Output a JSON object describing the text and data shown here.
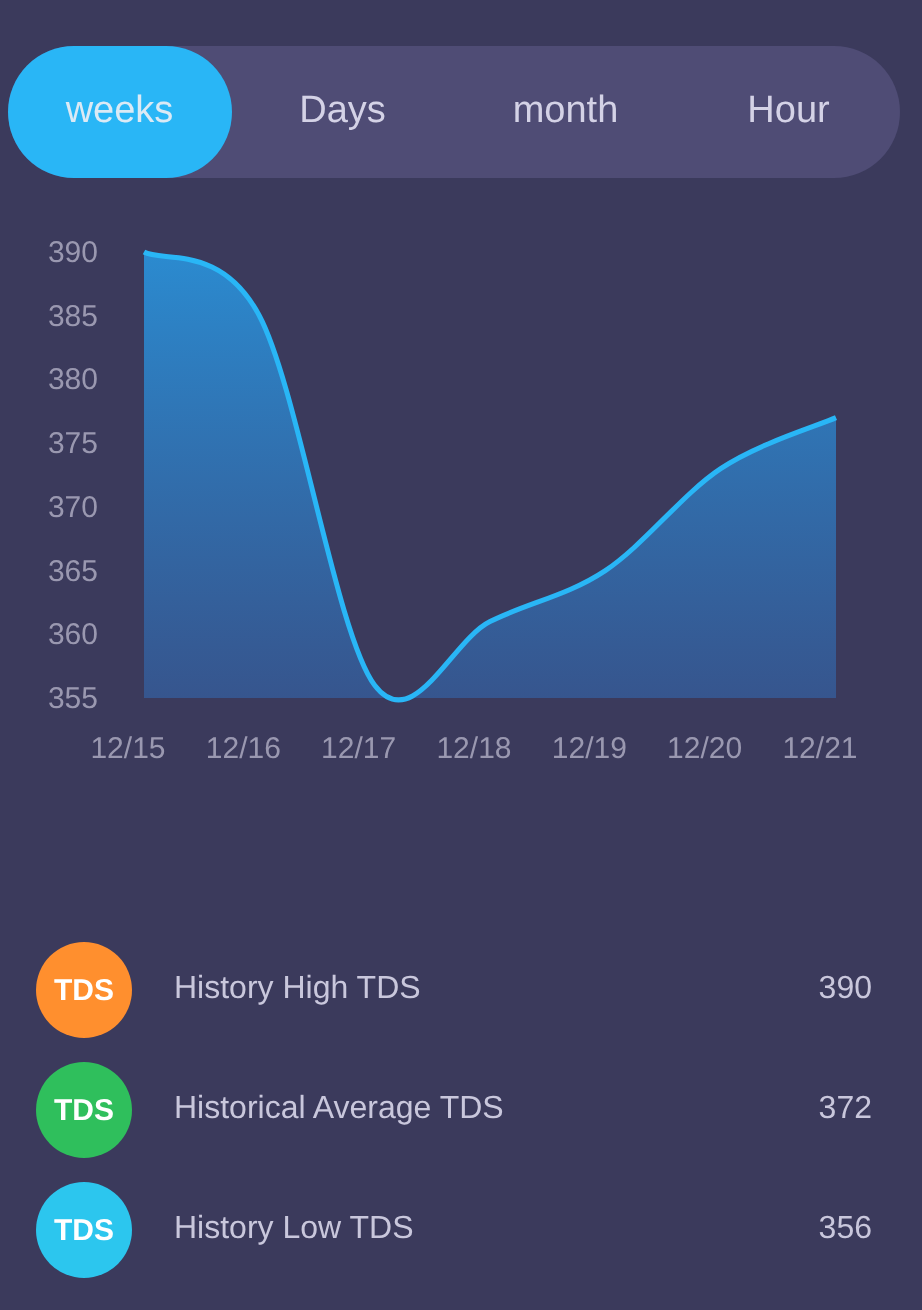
{
  "tabs": [
    {
      "label": "weeks",
      "selected": true
    },
    {
      "label": "Days",
      "selected": false
    },
    {
      "label": "month",
      "selected": false
    },
    {
      "label": "Hour",
      "selected": false
    }
  ],
  "chart": {
    "chart_data": {
      "type": "area",
      "categories": [
        "12/15",
        "12/16",
        "12/17",
        "12/18",
        "12/19",
        "12/20",
        "12/21"
      ],
      "values": [
        390,
        385,
        356,
        361,
        365,
        373,
        377
      ],
      "ylim": [
        355,
        390
      ],
      "yticks": [
        355,
        360,
        365,
        370,
        375,
        380,
        385,
        390
      ]
    }
  },
  "stats": [
    {
      "badge": "TDS",
      "label": "History High TDS",
      "value": "390",
      "color": "#ff8f2e"
    },
    {
      "badge": "TDS",
      "label": "Historical Average TDS",
      "value": "372",
      "color": "#2fbf5c"
    },
    {
      "badge": "TDS",
      "label": "History Low TDS",
      "value": "356",
      "color": "#2cc6ee"
    }
  ]
}
